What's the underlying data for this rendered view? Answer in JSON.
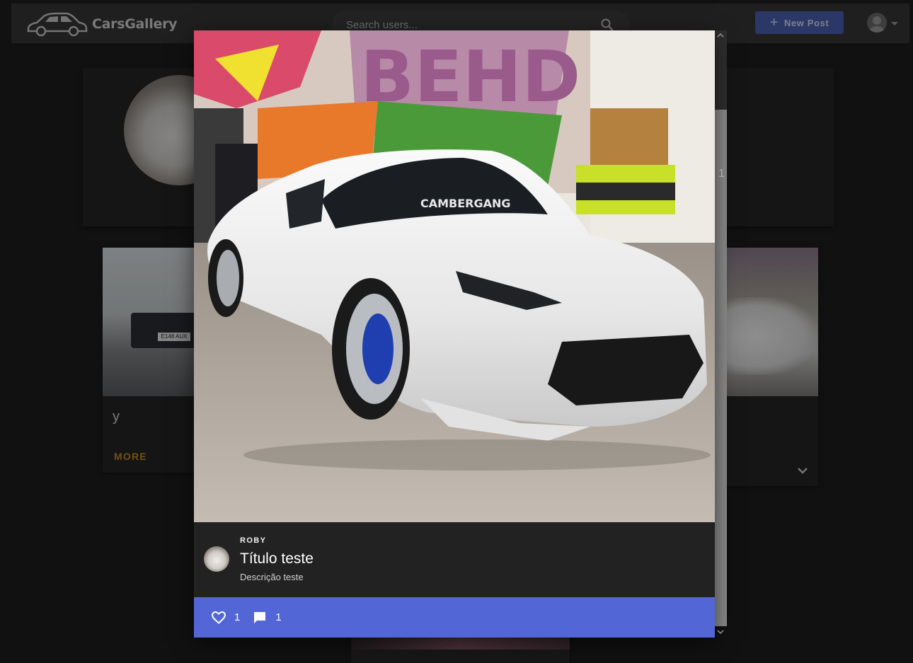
{
  "app": {
    "brand_name": "CarsGallery",
    "brand_icon": "car-logo-icon"
  },
  "header": {
    "search_placeholder": "Search users...",
    "search_icon": "search-icon",
    "new_post_label": "New Post",
    "new_post_icon": "plus-icon",
    "avatar_icon": "user-avatar-icon",
    "dropdown_icon": "caret-down-icon",
    "accent_color": "#4a5fb0"
  },
  "background": {
    "left_card": {
      "title": "y",
      "plate_text": "E148 AUX",
      "more_label": "MORE",
      "more_color": "#c98a1c"
    },
    "right_card": {
      "expand_icon": "chevron-down-icon"
    },
    "partial_count": "1"
  },
  "modal": {
    "author": "ROBY",
    "title": "Título teste",
    "description": "Descrição teste",
    "windshield_banner": "CAMBERGANG",
    "graffiti_text": "BEHD",
    "likes": "1",
    "comments": "1",
    "like_icon": "heart-outline-icon",
    "comment_icon": "comment-icon",
    "action_bar_color": "#5266d6"
  }
}
